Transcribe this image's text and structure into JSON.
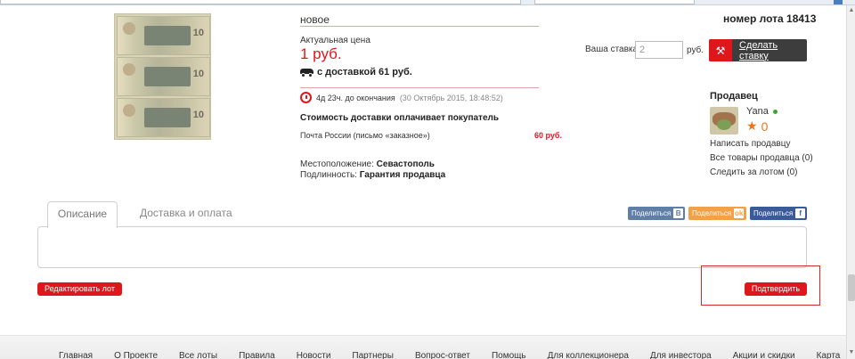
{
  "lot": {
    "condition": "новое",
    "lot_number": "номер лота 18413"
  },
  "price": {
    "label": "Актуальная цена",
    "value": "1 руб.",
    "with_delivery": "с доставкой 61 руб."
  },
  "timer": {
    "remaining": "4д 23ч. до окончания",
    "end_date": "(30 Октябрь 2015, 18:48:52)"
  },
  "shipping": {
    "title": "Стоимость доставки оплачивает покупатель",
    "method": "Почта России (письмо «заказное»)",
    "cost": "60 руб."
  },
  "details": {
    "location_label": "Местоположение:",
    "location_value": "Севастополь",
    "authenticity_label": "Подлинность:",
    "authenticity_value": "Гарантия продавца"
  },
  "bid": {
    "label": "Ваша ставка",
    "value": "2",
    "unit": "руб.",
    "button": "Сделать ставку"
  },
  "seller": {
    "title": "Продавец",
    "name": "Yana",
    "rating": "0",
    "links": [
      "Написать продавцу",
      "Все товары продавца (0)",
      "Следить за лотом (0)"
    ]
  },
  "tabs": [
    "Описание",
    "Доставка и оплата"
  ],
  "share": {
    "vk": "Поделиться",
    "vk_badge": "B",
    "ok": "Поделиться",
    "ok_badge": "ok",
    "fb": "Поделиться",
    "fb_badge": "f"
  },
  "actions": {
    "edit": "Редактировать лот",
    "confirm": "Подтвердить"
  },
  "banknote": {
    "denomination": "10"
  },
  "footer": [
    "Главная",
    "О Проекте",
    "Все лоты",
    "Правила",
    "Новости",
    "Партнеры",
    "Вопрос-ответ",
    "Помощь",
    "Для коллекционера",
    "Для инвестора",
    "Акции и скидки",
    "Карта"
  ],
  "colors": {
    "accent": "#e0161d",
    "dark_button": "#3d3d3d",
    "vk": "#5f7fa6",
    "ok": "#f2a148",
    "fb": "#3b5a9a"
  }
}
